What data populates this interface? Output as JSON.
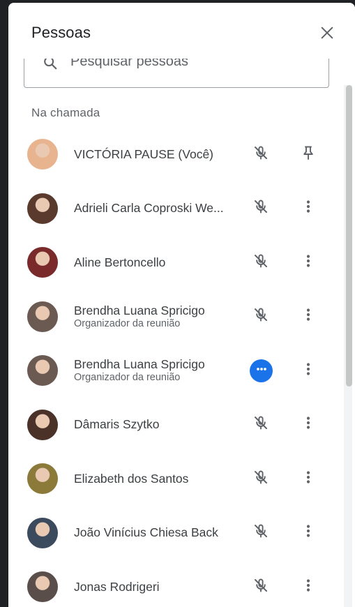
{
  "panel": {
    "title": "Pessoas",
    "close_icon": "close-icon"
  },
  "search": {
    "placeholder": "Pesquisar pessoas"
  },
  "section": {
    "title": "Na chamada"
  },
  "participants": [
    {
      "name": "VICTÓRIA PAUSE (Você)",
      "role": "",
      "status": "muted",
      "action": "pin-icon",
      "avatar_color": "#e7b48f"
    },
    {
      "name": "Adrieli Carla Coproski We...",
      "role": "",
      "status": "muted",
      "action": "more-vert-icon",
      "avatar_color": "#5b3a2e"
    },
    {
      "name": "Aline Bertoncello",
      "role": "",
      "status": "muted",
      "action": "more-vert-icon",
      "avatar_color": "#7a2a2a"
    },
    {
      "name": "Brendha Luana Spricigo",
      "role": "Organizador da reunião",
      "status": "muted",
      "action": "more-vert-icon",
      "avatar_color": "#6b5a52"
    },
    {
      "name": "Brendha Luana Spricigo",
      "role": "Organizador da reunião",
      "status": "speaking",
      "action": "more-vert-icon",
      "avatar_color": "#6b5a52"
    },
    {
      "name": "Dâmaris Szytko",
      "role": "",
      "status": "muted",
      "action": "more-vert-icon",
      "avatar_color": "#4a3228"
    },
    {
      "name": "Elizabeth dos Santos",
      "role": "",
      "status": "muted",
      "action": "more-vert-icon",
      "avatar_color": "#8c7a3a"
    },
    {
      "name": "João Vinícius Chiesa Back",
      "role": "",
      "status": "muted",
      "action": "more-vert-icon",
      "avatar_color": "#3b4a5c"
    },
    {
      "name": "Jonas Rodrigeri",
      "role": "",
      "status": "muted",
      "action": "more-vert-icon",
      "avatar_color": "#5a4e4a"
    }
  ],
  "colors": {
    "accent": "#1a73e8",
    "icon": "#5f6368"
  }
}
